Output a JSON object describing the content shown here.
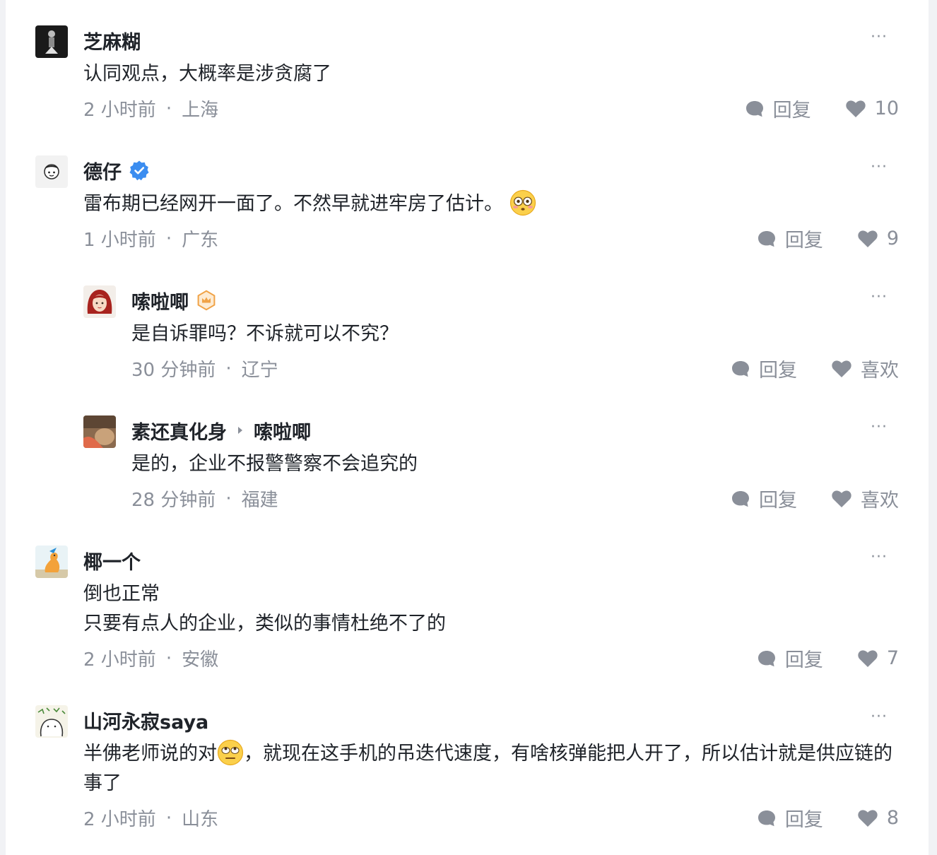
{
  "more_glyph": "···",
  "reply_label": "回复",
  "comments": [
    {
      "author": "芝麻糊",
      "avatar_icon": "dark-photo-avatar",
      "text": "认同观点，大概率是涉贪腐了",
      "time": "2 小时前",
      "location": "上海",
      "like_label": "10"
    },
    {
      "author": "德仔",
      "avatar_icon": "cartoon-face-avatar",
      "badge_icon": "verified-check-icon",
      "text": "雷布期已经网开一面了。不然早就进牢房了估计。",
      "emoji_icon": "flushed-face-emoji",
      "time": "1 小时前",
      "location": "广东",
      "like_label": "9"
    },
    {
      "author": "嗦啦唧",
      "avatar_icon": "red-hair-girl-avatar",
      "badge_icon": "level-badge-icon",
      "text": "是自诉罪吗？不诉就可以不究？",
      "time": "30 分钟前",
      "location": "辽宁",
      "like_label": "喜欢"
    },
    {
      "author": "素还真化身",
      "avatar_icon": "brown-photo-avatar",
      "reply_to": "嗦啦唧",
      "text": "是的，企业不报警警察不会追究的",
      "time": "28 分钟前",
      "location": "福建",
      "like_label": "喜欢"
    },
    {
      "author": "椰一个",
      "avatar_icon": "duck-avatar",
      "text_line1": "倒也正常",
      "text_line2": "只要有点人的企业，类似的事情杜绝不了的",
      "time": "2 小时前",
      "location": "安徽",
      "like_label": "7"
    },
    {
      "author": "山河永寂saya",
      "avatar_icon": "sketch-avatar",
      "text_before": "半佛老师说的对",
      "emoji_icon": "rolling-eyes-emoji",
      "text_after": "，就现在这手机的吊迭代速度，有啥核弹能把人开了，所以估计就是供应链的事了",
      "time": "2 小时前",
      "location": "山东",
      "like_label": "8"
    }
  ]
}
